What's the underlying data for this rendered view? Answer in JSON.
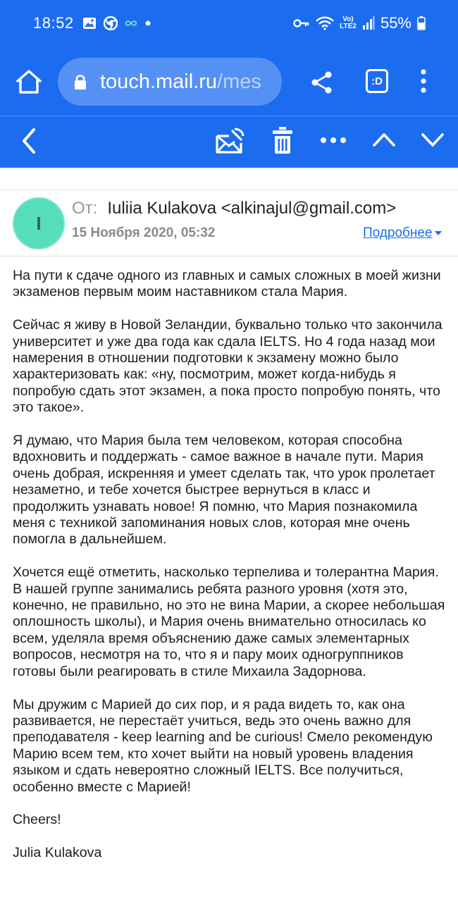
{
  "status_bar": {
    "time": "18:52",
    "battery": "55%",
    "network_label": "Vo) LTE2",
    "icons": [
      "gallery-icon",
      "chrome-icon",
      "infinity-icon",
      "dot-icon",
      "key-icon",
      "wifi-icon",
      "signal-icon",
      "battery-icon"
    ]
  },
  "browser": {
    "url_host": "touch.mail.ru",
    "url_path": "/mes",
    "tabs_label": ":D"
  },
  "mail_toolbar": {
    "icons": [
      "back-icon",
      "mark-unread-icon",
      "trash-icon",
      "more-icon",
      "previous-icon",
      "next-icon"
    ]
  },
  "message": {
    "avatar_letter": "I",
    "from_label": "От:",
    "from_value": "Iuliia Kulakova <alkinajul@gmail.com>",
    "date": "15 Ноября 2020, 05:32",
    "details_link": "Подробнее",
    "paragraphs": [
      "На пути к сдаче одного из главных и самых сложных в моей жизни экзаменов первым моим наставником стала Мария.",
      "Сейчас я живу в Новой Зеландии, буквально только что закончила университет и уже два года как сдала IELTS. Но 4 года назад мои намерения в отношении подготовки к экзамену можно было характеризовать как: «ну, посмотрим, может когда-нибудь я попробую сдать этот экзамен, а пока просто попробую понять, что это такое».",
      "Я думаю, что Мария была тем человеком, которая способна вдохновить и поддержать - самое важное в начале пути. Мария очень добрая, искренняя и умеет сделать так, что урок пролетает незаметно, и тебе хочется быстрее вернуться в класс и продолжить узнавать новое! Я помню, что Мария познакомила меня с техникой запоминания новых слов, которая мне очень помогла в дальнейшем.",
      "Хочется ещё отметить, насколько терпелива и толерантна Мария. В нашей группе занимались ребята разного уровня (хотя это, конечно, не правильно, но это не вина Марии, а скорее небольшая оплошность школы), и Мария очень внимательно относилась ко всем, уделяла время объяснению даже самых элементарных вопросов, несмотря на то, что я и пару моих одногруппников готовы были реагировать в стиле Михаила Задорнова.",
      "Мы дружим с Марией до сих пор, и я рада видеть то, как она развивается, не перестаёт учиться, ведь это очень важно для преподавателя - keep learning and be curious! Смело рекомендую Марию всем тем, кто хочет выйти на новый уровень владения языком и сдать невероятно сложный IELTS. Все получиться, особенно вместе с Марией!",
      "Cheers!",
      "Julia Kulakova"
    ]
  }
}
